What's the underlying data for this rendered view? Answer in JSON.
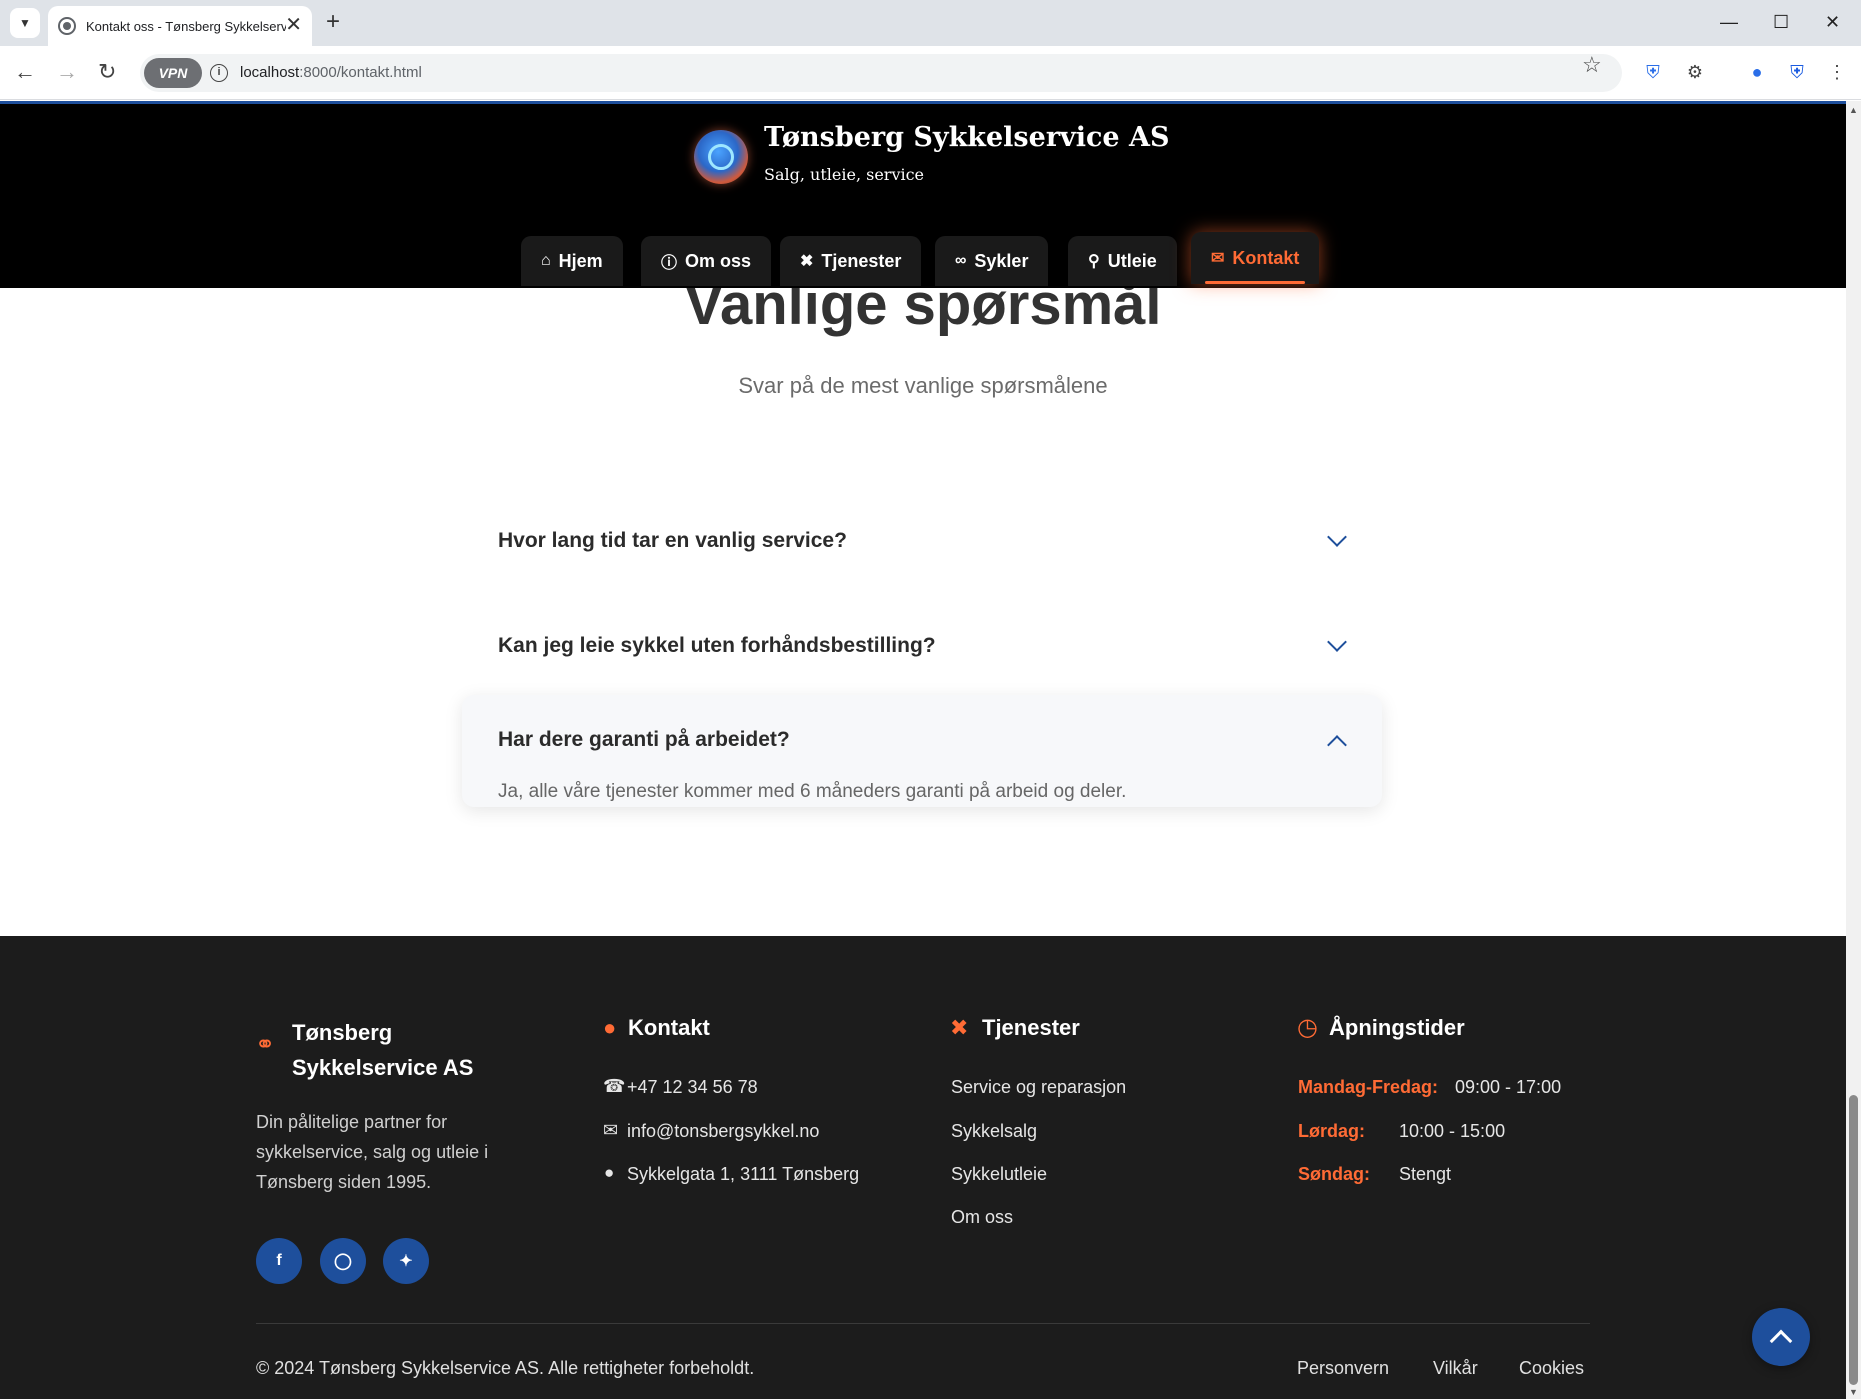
{
  "browser": {
    "tab_title": "Kontakt oss - Tønsberg Sykkelservice AS",
    "url_host": "localhost",
    "url_rest": ":8000/kontakt.html",
    "vpn_label": "VPN"
  },
  "header": {
    "title": "Tønsberg Sykkelservice AS",
    "subtitle": "Salg, utleie, service",
    "nav": [
      {
        "label": "Hjem",
        "icon": "home-icon"
      },
      {
        "label": "Om oss",
        "icon": "info-icon"
      },
      {
        "label": "Tjenester",
        "icon": "tools-icon"
      },
      {
        "label": "Sykler",
        "icon": "bicycle-icon"
      },
      {
        "label": "Utleie",
        "icon": "key-icon"
      },
      {
        "label": "Kontakt",
        "icon": "envelope-icon",
        "active": true
      }
    ]
  },
  "faq": {
    "title": "Vanlige spørsmål",
    "subtitle": "Svar på de mest vanlige spørsmålene",
    "items": [
      {
        "question": "Hvor lang tid tar en vanlig service?",
        "expanded": false
      },
      {
        "question": "Kan jeg leie sykkel uten forhåndsbestilling?",
        "expanded": false
      },
      {
        "question": "Har dere garanti på arbeidet?",
        "answer": "Ja, alle våre tjenester kommer med 6 måneders garanti på arbeid og deler.",
        "expanded": true
      }
    ]
  },
  "footer": {
    "about": {
      "title": "Tønsberg Sykkelservice AS",
      "title_line1": "Tønsberg",
      "title_line2": "Sykkelservice AS",
      "description": "Din pålitelige partner for sykkelservice, salg og utleie i Tønsberg siden 1995."
    },
    "contact": {
      "title": "Kontakt",
      "phone": "+47 12 34 56 78",
      "email": "info@tonsbergsykkel.no",
      "address": "Sykkelgata 1, 3111 Tønsberg"
    },
    "services": {
      "title": "Tjenester",
      "links": [
        "Service og reparasjon",
        "Sykkelsalg",
        "Sykkelutleie",
        "Om oss"
      ]
    },
    "hours": {
      "title": "Åpningstider",
      "rows": [
        {
          "day": "Mandag-Fredag:",
          "time": "09:00 - 17:00"
        },
        {
          "day": "Lørdag:",
          "time": "10:00 - 15:00"
        },
        {
          "day": "Søndag:",
          "time": "Stengt"
        }
      ]
    },
    "social": [
      "facebook-icon",
      "instagram-icon",
      "twitter-icon"
    ],
    "copyright": "© 2024 Tønsberg Sykkelservice AS. Alle rettigheter forbeholdt.",
    "legal_links": [
      "Personvern",
      "Vilkår",
      "Cookies"
    ]
  },
  "colors": {
    "accent": "#ff6b35",
    "primary": "#1e4f9c",
    "header_bg": "#000000",
    "footer_bg": "#1c1c1c"
  }
}
